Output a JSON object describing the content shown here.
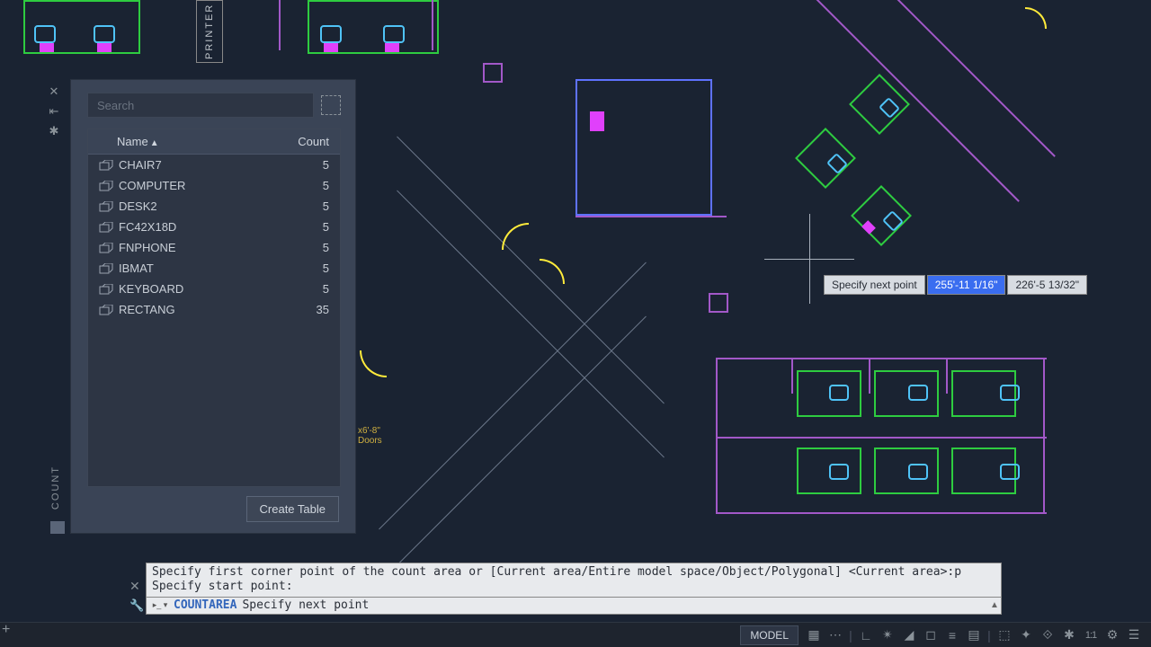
{
  "palette": {
    "title": "COUNT",
    "search_placeholder": "Search",
    "columns": {
      "name": "Name",
      "count": "Count"
    },
    "items": [
      {
        "name": "CHAIR7",
        "count": 5
      },
      {
        "name": "COMPUTER",
        "count": 5
      },
      {
        "name": "DESK2",
        "count": 5
      },
      {
        "name": "FC42X18D",
        "count": 5
      },
      {
        "name": "FNPHONE",
        "count": 5
      },
      {
        "name": "IBMAT",
        "count": 5
      },
      {
        "name": "KEYBOARD",
        "count": 5
      },
      {
        "name": "RECTANG",
        "count": 35
      }
    ],
    "create_table": "Create Table"
  },
  "dynamic_input": {
    "prompt": "Specify next point",
    "coord_x": "255'-11 1/16\"",
    "coord_y": "226'-5 13/32\""
  },
  "command": {
    "history_line1": "Specify first corner point of the count area or [Current area/Entire model space/Object/Polygonal] <Current area>:p",
    "history_line2": "Specify start point:",
    "active_cmd": "COUNTAREA",
    "active_prompt": "Specify next point"
  },
  "drawing_labels": {
    "printer": "PRINTER",
    "doors_dim": "x6'-8\"",
    "doors": "Doors"
  },
  "status": {
    "model": "MODEL",
    "ratio": "1:1"
  }
}
